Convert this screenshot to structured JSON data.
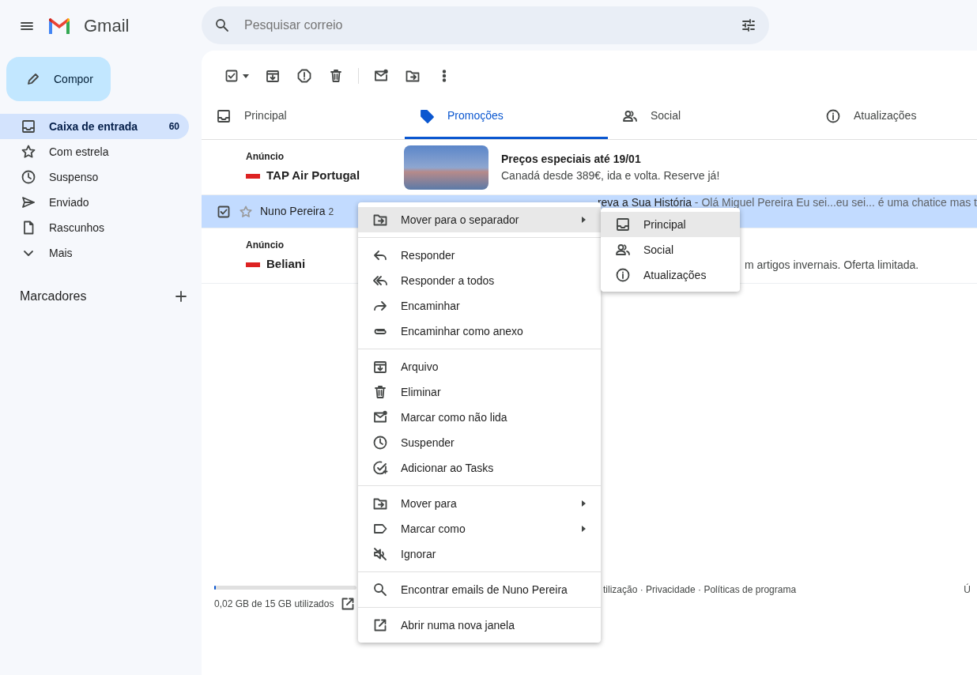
{
  "app": {
    "name": "Gmail"
  },
  "search": {
    "placeholder": "Pesquisar correio"
  },
  "compose": {
    "label": "Compor"
  },
  "sidebar": {
    "items": [
      {
        "label": "Caixa de entrada",
        "count": "60",
        "selected": true
      },
      {
        "label": "Com estrela",
        "selected": false
      },
      {
        "label": "Suspenso",
        "selected": false
      },
      {
        "label": "Enviado",
        "selected": false
      },
      {
        "label": "Rascunhos",
        "selected": false
      },
      {
        "label": "Mais",
        "selected": false
      }
    ],
    "labels_title": "Marcadores"
  },
  "tabs": [
    {
      "label": "Principal",
      "selected": false
    },
    {
      "label": "Promoções",
      "selected": true
    },
    {
      "label": "Social",
      "selected": false
    },
    {
      "label": "Atualizações",
      "selected": false
    }
  ],
  "rows": [
    {
      "kind": "ad",
      "tag": "Anúncio",
      "sender": "TAP Air Portugal",
      "subject": "Preços especiais até 19/01",
      "snippet": "Canadá desde 389€, ida e volta. Reserve já!"
    },
    {
      "kind": "email",
      "selected": true,
      "checked": true,
      "starred": false,
      "sender": "Nuno Pereira",
      "count": "2",
      "subject": "reva a Sua História",
      "snippet": "- Olá Miguel Pereira Eu sei...eu sei... é uma chatice mas t"
    },
    {
      "kind": "ad",
      "tag": "Anúncio",
      "sender": "Beliani",
      "snippet": "m artigos invernais. Oferta limitada."
    }
  ],
  "footer": {
    "storage": "0,02 GB de 15 GB utilizados",
    "storage_meter": {
      "level": 0.01
    },
    "links": "tilização · Privacidade · Políticas de programa",
    "right": "Ú"
  },
  "menu": {
    "sections": [
      [
        {
          "label": "Mover para o separador",
          "submenu": true,
          "highlighted": true
        }
      ],
      [
        {
          "label": "Responder",
          "submenu": false,
          "highlighted": false
        },
        {
          "label": "Responder a todos",
          "submenu": false,
          "highlighted": false
        },
        {
          "label": "Encaminhar",
          "submenu": false,
          "highlighted": false
        },
        {
          "label": "Encaminhar como anexo",
          "submenu": false,
          "highlighted": false
        }
      ],
      [
        {
          "label": "Arquivo",
          "submenu": false,
          "highlighted": false
        },
        {
          "label": "Eliminar",
          "submenu": false,
          "highlighted": false
        },
        {
          "label": "Marcar como não lida",
          "submenu": false,
          "highlighted": false
        },
        {
          "label": "Suspender",
          "submenu": false,
          "highlighted": false
        },
        {
          "label": "Adicionar ao Tasks",
          "submenu": false,
          "highlighted": false
        }
      ],
      [
        {
          "label": "Mover para",
          "submenu": true,
          "highlighted": false
        },
        {
          "label": "Marcar como",
          "submenu": true,
          "highlighted": false
        },
        {
          "label": "Ignorar",
          "submenu": false,
          "highlighted": false
        }
      ],
      [
        {
          "label": "Encontrar emails de Nuno Pereira",
          "submenu": false,
          "highlighted": false
        }
      ],
      [
        {
          "label": "Abrir numa nova janela",
          "submenu": false,
          "highlighted": false
        }
      ]
    ],
    "submenu": [
      {
        "label": "Principal",
        "highlighted": true
      },
      {
        "label": "Social",
        "highlighted": false
      },
      {
        "label": "Atualizações",
        "highlighted": false
      }
    ]
  }
}
